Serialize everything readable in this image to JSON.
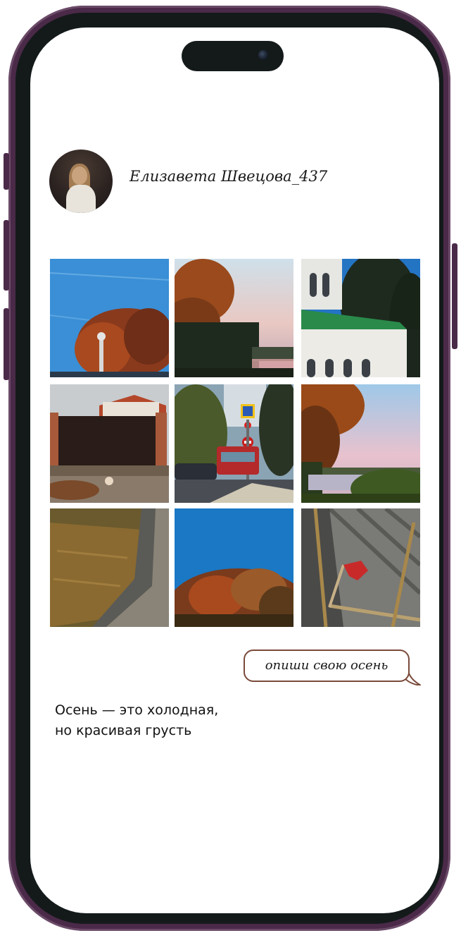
{
  "profile": {
    "username": "Елизавета Швецова_437"
  },
  "gallery": {
    "photos": [
      {
        "subject": "autumn-tree-blue-sky"
      },
      {
        "subject": "tree-sunset-lake"
      },
      {
        "subject": "white-church-green-roof"
      },
      {
        "subject": "brown-gate-cat"
      },
      {
        "subject": "red-tram-street"
      },
      {
        "subject": "autumn-tree-lake"
      },
      {
        "subject": "dry-grass-curb"
      },
      {
        "subject": "autumn-bush-blue-sky"
      },
      {
        "subject": "red-leaf-on-asphalt"
      }
    ]
  },
  "prompt_bubble": {
    "text": "опиши свою осень"
  },
  "quote": {
    "line1": "Осень — это холодная,",
    "line2": "но красивая грусть"
  },
  "colors": {
    "frame": "#4a2a48",
    "bezel": "#141a1a",
    "bubble_border": "#7a4a3a"
  }
}
